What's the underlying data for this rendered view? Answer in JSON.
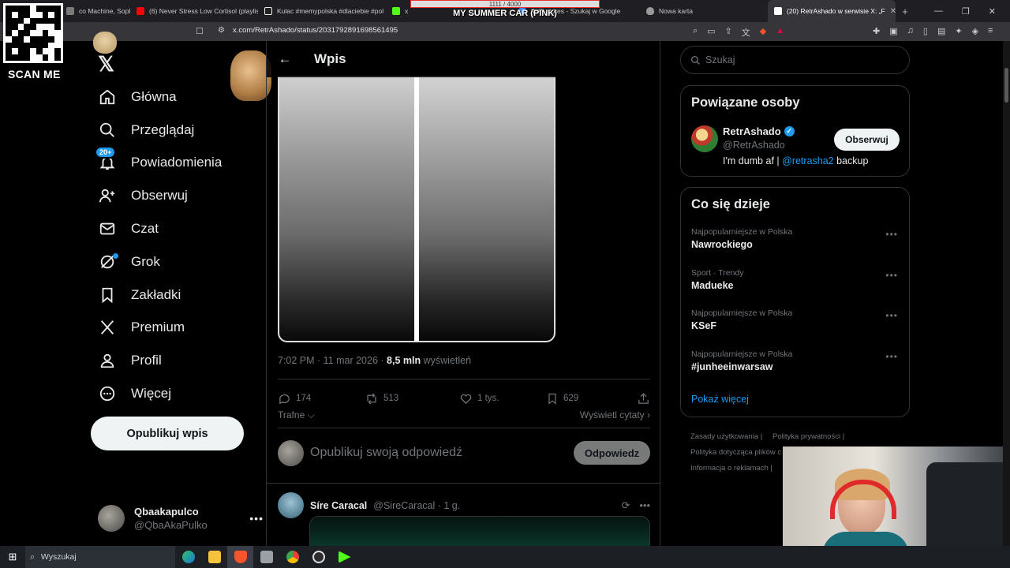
{
  "browser": {
    "tabs": [
      {
        "title": "co Machine, Sophie",
        "color": "#7a7a7a"
      },
      {
        "title": "(6) Never Stress Low Cortisol (playlis",
        "color": "#ff0000"
      },
      {
        "title": "Kulac #memypolska #dlaciebie #pol",
        "color": "#eeeeee"
      },
      {
        "title": "x",
        "color": "#53fc18"
      },
      {
        "title": "thrift stores - Szukaj w Google",
        "color": "#4285f4"
      },
      {
        "title": "Nowa karta",
        "color": "#999999"
      },
      {
        "title": "(20) RetrAshado w serwisie X: „F",
        "color": "#ffffff",
        "active": true
      }
    ],
    "url": "x.com/RetrAshado/status/2031792891698561495"
  },
  "overlay": {
    "scan_label": "SCAN ME",
    "banner_counter": "1111 / 4000",
    "banner_title": "MY SUMMER CAR (PINK)"
  },
  "nav": {
    "items": [
      {
        "label": "Główna",
        "icon": "home-icon"
      },
      {
        "label": "Przeglądaj",
        "icon": "search-icon"
      },
      {
        "label": "Powiadomienia",
        "icon": "bell-icon",
        "badge": "20+"
      },
      {
        "label": "Obserwuj",
        "icon": "add-person-icon"
      },
      {
        "label": "Czat",
        "icon": "mail-icon"
      },
      {
        "label": "Grok",
        "icon": "grok-icon"
      },
      {
        "label": "Zakładki",
        "icon": "bookmark-icon"
      },
      {
        "label": "Premium",
        "icon": "x-icon"
      },
      {
        "label": "Profil",
        "icon": "person-icon"
      },
      {
        "label": "Więcej",
        "icon": "more-circle-icon"
      }
    ],
    "post_button": "Opublikuj wpis"
  },
  "account": {
    "display_name": "Qbaakapulco",
    "handle": "@QbaAkaPulko"
  },
  "post": {
    "header_title": "Wpis",
    "time": "7:02 PM · 11 mar 2026 ·",
    "views_count": "8,5 mln",
    "views_label": "wyświetleń",
    "replies": "174",
    "reposts": "513",
    "likes": "1 tys.",
    "bookmarks": "629",
    "sort_label": "Trafne",
    "quotes_label": "Wyświetl cytaty",
    "composer_placeholder": "Opublikuj swoją odpowiedź",
    "reply_button": "Odpowiedz"
  },
  "reply": {
    "name": "Síre Caracal",
    "handle": "@SireCaracal · 1 g."
  },
  "right": {
    "search_placeholder": "Szukaj",
    "related_title": "Powiązane osoby",
    "person": {
      "name": "RetrAshado",
      "handle": "@RetrAshado",
      "bio_prefix": "I'm dumb af |",
      "bio_link": "@retrasha2",
      "bio_suffix": "backup",
      "follow": "Obserwuj"
    },
    "trends_title": "Co się dzieje",
    "trends": [
      {
        "context": "Najpopularniejsze w Polska",
        "name": "Nawrockiego"
      },
      {
        "context": "Sport · Trendy",
        "name": "Madueke"
      },
      {
        "context": "Najpopularniejsze w Polska",
        "name": "KSeF"
      },
      {
        "context": "Najpopularniejsze w Polska",
        "name": "#junheeinwarsaw"
      }
    ],
    "show_more": "Pokaż więcej",
    "footer": {
      "terms": "Zasady użytkowania",
      "privacy": "Polityka prywatności",
      "cookies": "Polityka dotycząca plików c",
      "ads": "Informacja o reklamach"
    }
  },
  "taskbar": {
    "search": "Wyszukaj"
  }
}
